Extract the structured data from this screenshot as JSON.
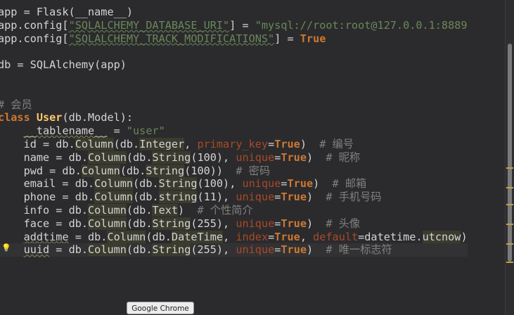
{
  "tooltip": "Google Chrome",
  "code_lines": [
    [
      {
        "t": "app = Flask(__name__)"
      }
    ],
    [
      {
        "t": "app.config["
      },
      {
        "t": "\"SQLALCHEMY_DATABASE_URI\"",
        "c": "str sq"
      },
      {
        "t": "] = "
      },
      {
        "t": "\"mysql://root:root@127.0.0.1:8889",
        "c": "str"
      }
    ],
    [
      {
        "t": "app.config["
      },
      {
        "t": "\"SQLALCHEMY_TRACK_MODIFICATIONS\"",
        "c": "str sq"
      },
      {
        "t": "] = "
      },
      {
        "t": "True",
        "c": "bool"
      }
    ],
    [
      {
        "t": ""
      }
    ],
    [
      {
        "t": "db = SQLAlchemy(app)"
      }
    ],
    [
      {
        "t": ""
      }
    ],
    [
      {
        "t": ""
      }
    ],
    [
      {
        "t": "# 会员",
        "c": "cm"
      }
    ],
    [
      {
        "t": "class ",
        "c": "kw"
      },
      {
        "t": "User",
        "c": "cls"
      },
      {
        "t": "(db.Model):"
      }
    ],
    [
      {
        "t": "    "
      },
      {
        "t": "__tablename__",
        "c": "sqw"
      },
      {
        "t": " = "
      },
      {
        "t": "\"user\"",
        "c": "str"
      }
    ],
    [
      {
        "t": "    id = db."
      },
      {
        "t": "Column",
        "c": "hl"
      },
      {
        "t": "(db."
      },
      {
        "t": "Integer",
        "c": "hl"
      },
      {
        "t": ", "
      },
      {
        "t": "primary_key",
        "c": "param"
      },
      {
        "t": "="
      },
      {
        "t": "True",
        "c": "bool"
      },
      {
        "t": ")  "
      },
      {
        "t": "# 编号",
        "c": "cm"
      }
    ],
    [
      {
        "t": "    name = db."
      },
      {
        "t": "Column",
        "c": "hl"
      },
      {
        "t": "(db."
      },
      {
        "t": "String",
        "c": "hl"
      },
      {
        "t": "(100), "
      },
      {
        "t": "unique",
        "c": "param"
      },
      {
        "t": "="
      },
      {
        "t": "True",
        "c": "bool"
      },
      {
        "t": ")  "
      },
      {
        "t": "# 昵称",
        "c": "cm"
      }
    ],
    [
      {
        "t": "    pwd = db."
      },
      {
        "t": "Column",
        "c": "hl"
      },
      {
        "t": "(db."
      },
      {
        "t": "String",
        "c": "hl"
      },
      {
        "t": "(100))  "
      },
      {
        "t": "# 密码",
        "c": "cm"
      }
    ],
    [
      {
        "t": "    email = db."
      },
      {
        "t": "Column",
        "c": "hl"
      },
      {
        "t": "(db."
      },
      {
        "t": "String",
        "c": "hl"
      },
      {
        "t": "(100), "
      },
      {
        "t": "unique",
        "c": "param"
      },
      {
        "t": "="
      },
      {
        "t": "True",
        "c": "bool"
      },
      {
        "t": ")  "
      },
      {
        "t": "# 邮箱",
        "c": "cm"
      }
    ],
    [
      {
        "t": "    phone = db."
      },
      {
        "t": "Column",
        "c": "hl"
      },
      {
        "t": "(db."
      },
      {
        "t": "string",
        "c": "hl"
      },
      {
        "t": "(11), "
      },
      {
        "t": "unique",
        "c": "param"
      },
      {
        "t": "="
      },
      {
        "t": "True",
        "c": "bool"
      },
      {
        "t": ")  "
      },
      {
        "t": "# 手机号码",
        "c": "cm"
      }
    ],
    [
      {
        "t": "    info = db."
      },
      {
        "t": "Column",
        "c": "hl"
      },
      {
        "t": "(db."
      },
      {
        "t": "Text",
        "c": "hl"
      },
      {
        "t": ")  "
      },
      {
        "t": "# 个性简介",
        "c": "cm"
      }
    ],
    [
      {
        "t": "    face = db."
      },
      {
        "t": "Column",
        "c": "hl"
      },
      {
        "t": "(db."
      },
      {
        "t": "String",
        "c": "hl"
      },
      {
        "t": "(255), "
      },
      {
        "t": "unique",
        "c": "param"
      },
      {
        "t": "="
      },
      {
        "t": "True",
        "c": "bool"
      },
      {
        "t": ")  "
      },
      {
        "t": "# 头像",
        "c": "cm"
      }
    ],
    [
      {
        "t": "    "
      },
      {
        "t": "addtime",
        "c": "sqw"
      },
      {
        "t": " = db."
      },
      {
        "t": "Column",
        "c": "hl"
      },
      {
        "t": "(db."
      },
      {
        "t": "DateTime",
        "c": "hl"
      },
      {
        "t": ", "
      },
      {
        "t": "index",
        "c": "param"
      },
      {
        "t": "="
      },
      {
        "t": "True",
        "c": "bool"
      },
      {
        "t": ", "
      },
      {
        "t": "default",
        "c": "param"
      },
      {
        "t": "=datetime."
      },
      {
        "t": "utcnow",
        "c": "hl"
      },
      {
        "t": ")"
      }
    ],
    [
      {
        "t": "    "
      },
      {
        "t": "uuid",
        "c": "sqw"
      },
      {
        "t": " = db."
      },
      {
        "t": "Column",
        "c": "hl"
      },
      {
        "t": "(db."
      },
      {
        "t": "String",
        "c": "hl"
      },
      {
        "t": "(255), "
      },
      {
        "t": "unique",
        "c": "param"
      },
      {
        "t": "="
      },
      {
        "t": "True",
        "c": "bool"
      },
      {
        "t": ")  "
      },
      {
        "t": "# 唯一标志符",
        "c": "cm"
      }
    ]
  ]
}
